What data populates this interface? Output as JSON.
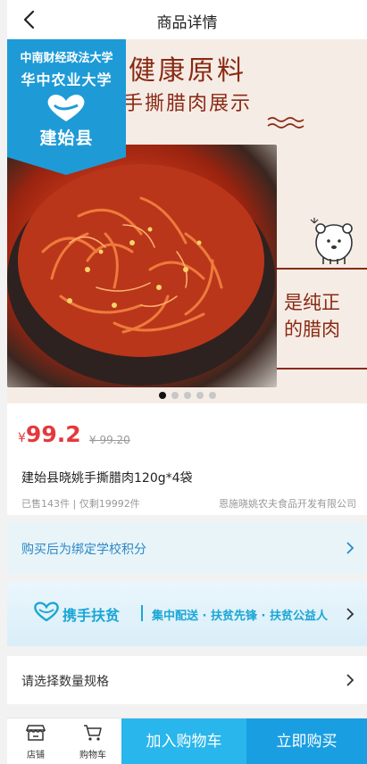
{
  "header": {
    "title": "商品详情"
  },
  "hero": {
    "headline": "健康原料",
    "subline": "手撕腊肉展示",
    "side_text_1": "是纯正",
    "side_text_2": "的腊肉",
    "badge": {
      "line1": "中南财经政法大学",
      "line2": "华中农业大学",
      "line3": "建始县"
    },
    "carousel": {
      "count": 5,
      "active": 1
    }
  },
  "price": {
    "currency": "¥",
    "current": "99.2",
    "original": "¥ 99.20"
  },
  "product": {
    "name": "建始县晓姚手撕腊肉120g*4袋",
    "sales": "已售143件 | 仅剩19992件",
    "seller": "恩施晓姚农夫食品开发有限公司"
  },
  "points": {
    "label": "购买后为绑定学校积分"
  },
  "banner": {
    "title": "携手扶贫",
    "subtitle": "集中配送 · 扶贫先锋 · 扶贫公益人"
  },
  "spec": {
    "label": "请选择数量规格"
  },
  "bottom": {
    "store_label": "店铺",
    "cart_label": "购物车",
    "add_cart": "加入购物车",
    "buy_now": "立即购买"
  },
  "colors": {
    "price_red": "#e4393c",
    "accent_blue": "#1a9ee2",
    "light_blue": "#29b6ec",
    "brand_brown": "#8a2a13"
  }
}
